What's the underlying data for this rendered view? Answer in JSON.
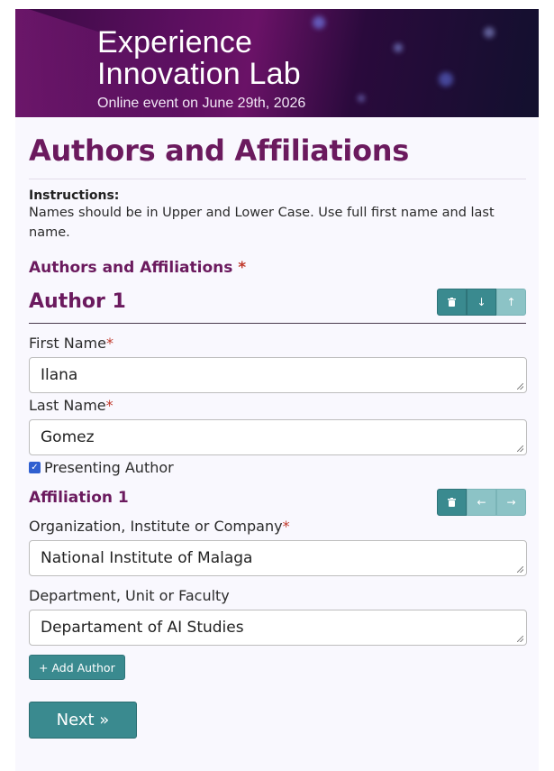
{
  "banner": {
    "title_line1": "Experience",
    "title_line2": "Innovation Lab",
    "subtitle": "Online event on June 29th, 2026"
  },
  "page_title": "Authors and Affiliations",
  "instructions": {
    "heading": "Instructions:",
    "text": "Names should be in Upper and Lower Case. Use full first name and last name."
  },
  "section": {
    "label": "Authors and Affiliations",
    "required_mark": "*"
  },
  "author": {
    "title": "Author 1",
    "buttons": {
      "delete_icon": "trash-icon",
      "down_icon": "arrow-down-icon",
      "up_icon": "arrow-up-icon"
    },
    "first_name": {
      "label": "First Name",
      "required_mark": "*",
      "value": "Ilana"
    },
    "last_name": {
      "label": "Last Name",
      "required_mark": "*",
      "value": "Gomez"
    },
    "presenting": {
      "label": "Presenting Author",
      "checked": true
    }
  },
  "affiliation": {
    "title": "Affiliation 1",
    "buttons": {
      "delete_icon": "trash-icon",
      "left_icon": "arrow-left-icon",
      "right_icon": "arrow-right-icon"
    },
    "organization": {
      "label": "Organization, Institute or Company",
      "required_mark": "*",
      "value": "National Institute of Malaga"
    },
    "department": {
      "label": "Department, Unit or Faculty",
      "value": "Departament of AI Studies"
    }
  },
  "add_author_label": "+ Add Author",
  "next_label": "Next »",
  "colors": {
    "brand_purple": "#6b1a5e",
    "teal": "#3a8a8f",
    "teal_disabled": "#8cc3c6",
    "required_red": "#c0392b"
  }
}
